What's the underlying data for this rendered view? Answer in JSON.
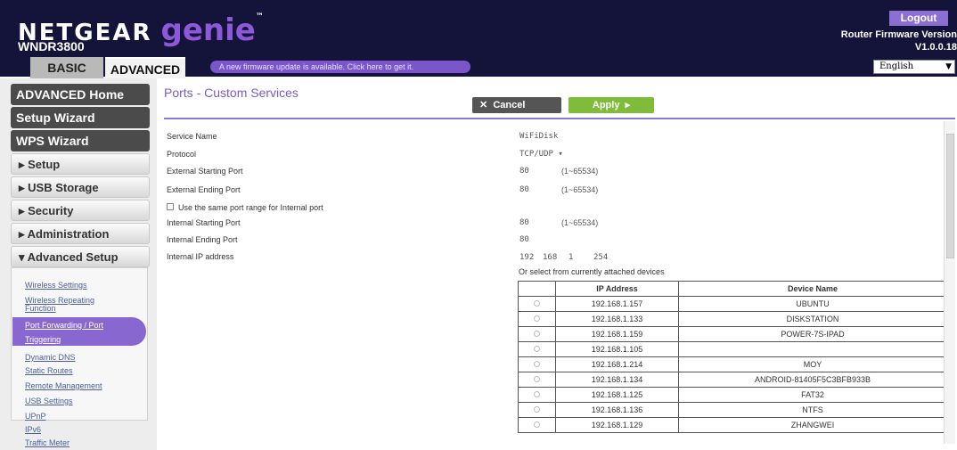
{
  "header": {
    "brand": "NETGEAR",
    "genie": "genie",
    "tm": "™",
    "model": "WNDR3800",
    "logout": "Logout",
    "fw_label": "Router Firmware Version",
    "fw_version": "V1.0.0.18"
  },
  "tabs": {
    "basic": "BASIC",
    "advanced": "ADVANCED"
  },
  "ticker": "A new firmware update is available. Click here to get it.",
  "language": {
    "selected": "English",
    "arrow": "▼"
  },
  "sidebar": {
    "advanced_home": "ADVANCED Home",
    "setup_wizard": "Setup Wizard",
    "wps_wizard": "WPS Wizard",
    "setup": "▸ Setup",
    "usb": "▸ USB Storage",
    "security": "▸ Security",
    "admin": "▸ Administration",
    "adv_setup": "▾ Advanced Setup",
    "sub": [
      "Wireless Settings",
      "Wireless Repeating",
      "Function",
      "Port Forwarding / Port",
      "Triggering",
      "Dynamic DNS",
      "Static Routes",
      "Remote Management",
      "USB Settings",
      "UPnP",
      "IPv6",
      "Traffic Meter"
    ]
  },
  "page": {
    "title": "Ports - Custom Services",
    "cancel": "Cancel",
    "cancel_icon": "✕",
    "apply": "Apply",
    "apply_icon": "▸"
  },
  "form": {
    "service_name_label": "Service Name",
    "service_name": "WiFiDisk",
    "protocol_label": "Protocol",
    "protocol": "TCP/UDP ▾",
    "ext_start_label": "External Starting Port",
    "ext_start": "80",
    "range1": "(1~65534)",
    "ext_end_label": "External Ending Port",
    "ext_end": "80",
    "range2": "(1~65534)",
    "same_range_label": "Use the same port range for Internal port",
    "int_start_label": "Internal Starting Port",
    "int_start": "80",
    "range3": "(1~65534)",
    "int_end_label": "Internal Ending Port",
    "int_end": "80",
    "ip_label": "Internal IP address",
    "ip1": "192",
    "ip2": "168",
    "ip3": "1",
    "ip4": "254",
    "select_from": "Or select from currently attached devices"
  },
  "devices": {
    "headers": [
      "",
      "IP Address",
      "Device Name"
    ],
    "rows": [
      [
        "192.168.1.157",
        "UBUNTU"
      ],
      [
        "192.168.1.133",
        "DISKSTATION"
      ],
      [
        "192.168.1.159",
        "POWER-7S-IPAD"
      ],
      [
        "192.168.1.105",
        ""
      ],
      [
        "192.168.1.214",
        "MOY"
      ],
      [
        "192.168.1.134",
        "ANDROID-81405F5C3BFB933B"
      ],
      [
        "192.168.1.125",
        "FAT32"
      ],
      [
        "192.168.1.136",
        "NTFS"
      ],
      [
        "192.168.1.129",
        "ZHANGWEI"
      ]
    ]
  },
  "colors": {
    "header": "#14143a",
    "accent": "#8c6fd3",
    "apply": "#7fbc3a"
  }
}
